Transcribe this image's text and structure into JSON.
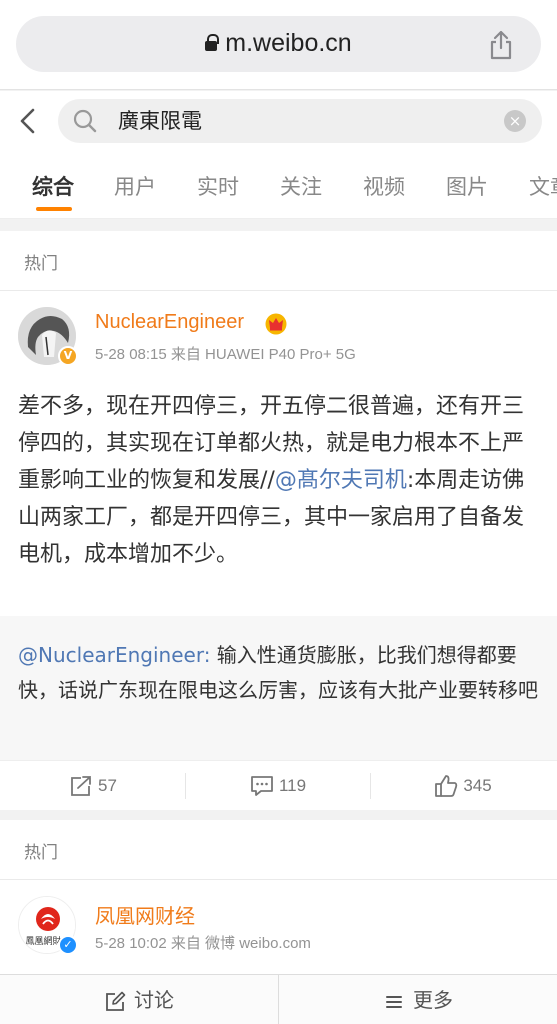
{
  "browser": {
    "url": "m.weibo.cn"
  },
  "search": {
    "query": "廣東限電",
    "clear_label": "×"
  },
  "tabs": [
    "综合",
    "用户",
    "实时",
    "关注",
    "视频",
    "图片",
    "文章"
  ],
  "sections": [
    {
      "label": "热门"
    },
    {
      "label": "热门"
    }
  ],
  "posts": [
    {
      "author": "NuclearEngineer",
      "meta": "5-28 08:15 来自 HUAWEI P40 Pro+ 5G",
      "text_part1": "差不多，现在开四停三，开五停二很普遍，还有开三停四的，其实现在订单都火热，就是电力根本不上严重影响工业的恢复和发展//",
      "mention": "@髙尔夫司机",
      "text_part2": ":本周走访佛山两家工厂，都是开四停三，其中一家启用了自备发电机，成本增加不少。",
      "retweet_author": "@NuclearEngineer:",
      "retweet_text": " 输入性通货膨胀，比我们想得都要快，话说广东现在限电这么厉害，应该有大批产业要转移吧",
      "reposts": "57",
      "comments": "119",
      "likes": "345",
      "verified": "V"
    },
    {
      "author": "凤凰网财经",
      "meta": "5-28 10:02 来自 微博 weibo.com",
      "logo_text": "鳳凰網財經",
      "verified": "✓"
    }
  ],
  "bottom_bar": {
    "discuss": "讨论",
    "more": "更多"
  },
  "colors": {
    "accent": "#ff8200",
    "author": "#f07b1a",
    "link": "#5078b4"
  }
}
